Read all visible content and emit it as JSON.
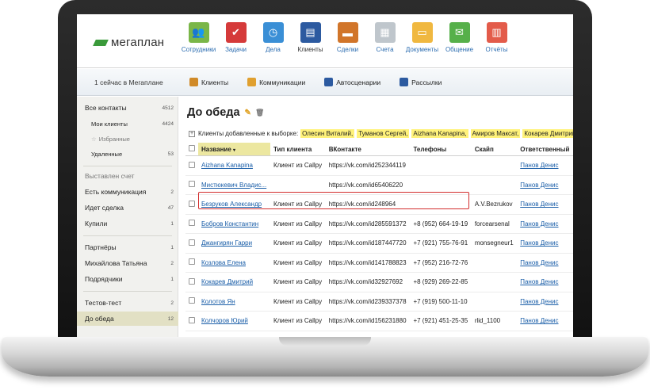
{
  "app": {
    "logo_text": "мегаплан"
  },
  "nav": [
    {
      "label": "Сотрудники",
      "icon": "people-icon",
      "color": "#7ab648"
    },
    {
      "label": "Задачи",
      "icon": "checklist-icon",
      "color": "#d53a3a"
    },
    {
      "label": "Дела",
      "icon": "clock-icon",
      "color": "#3a8fd6"
    },
    {
      "label": "Клиенты",
      "icon": "contact-book-icon",
      "color": "#2c5aa0",
      "active": true
    },
    {
      "label": "Сделки",
      "icon": "briefcase-icon",
      "color": "#d1752a"
    },
    {
      "label": "Счета",
      "icon": "invoice-icon",
      "color": "#bfc6cc"
    },
    {
      "label": "Документы",
      "icon": "folder-icon",
      "color": "#f0b840"
    },
    {
      "label": "Общение",
      "icon": "chat-icon",
      "color": "#56b04a"
    },
    {
      "label": "Отчёты",
      "icon": "report-chart-icon",
      "color": "#e35b4a"
    }
  ],
  "subbar": {
    "online": "1 сейчас в Мегаплане",
    "tabs": [
      {
        "label": "Клиенты",
        "icon": "clients-icon",
        "color": "#d08a28"
      },
      {
        "label": "Коммуникации",
        "icon": "handshake-icon",
        "color": "#e0a030"
      },
      {
        "label": "Автосценарии",
        "icon": "refresh-icon",
        "color": "#2c5aa0"
      },
      {
        "label": "Рассылки",
        "icon": "newsletter-icon",
        "color": "#2c5aa0"
      }
    ]
  },
  "sidebar": {
    "all_contacts": {
      "label": "Все контакты",
      "count": "4512"
    },
    "my_clients": {
      "label": "Мои клиенты",
      "count": "4424"
    },
    "favorites": {
      "label": "Избранные"
    },
    "deleted": {
      "label": "Удаленные",
      "count": "53"
    },
    "invoice": {
      "label": "Выставлен счет"
    },
    "communication": {
      "label": "Есть коммуникация",
      "count": "2"
    },
    "deal": {
      "label": "Идет сделка",
      "count": "47"
    },
    "bought": {
      "label": "Купили",
      "count": "1"
    },
    "partners": {
      "label": "Партнёры",
      "count": "1"
    },
    "mikhailova": {
      "label": "Михайлова Татьяна",
      "count": "2"
    },
    "contractors": {
      "label": "Подрядчики",
      "count": "1"
    },
    "test": {
      "label": "Тестов-тест",
      "count": "2"
    },
    "before_lunch": {
      "label": "До обеда",
      "count": "12"
    }
  },
  "main": {
    "title": "До обеда",
    "filter_label": "Клиенты добавленные к выборке:",
    "filter_chips": [
      "Олесин Виталий,",
      "Туманов Сергей,",
      "Aizhana Kanapina,",
      "Амиров Максат,",
      "Кокарев Дмитрий,"
    ]
  },
  "table": {
    "columns": [
      "Название",
      "Тип клиента",
      "ВКонтакте",
      "Телефоны",
      "Скайп",
      "Ответственный"
    ],
    "rows": [
      {
        "name": "Aizhana Kanapina",
        "type": "Клиент из Callpy",
        "vk": "https://vk.com/id252344119",
        "phone": "",
        "skype": "",
        "owner": "Панов Денис"
      },
      {
        "name": "Мистюкевич Владис...",
        "type": "",
        "vk": "https://vk.com/id65406220",
        "phone": "",
        "skype": "",
        "owner": "Панов Денис"
      },
      {
        "name": "Безруков Александр",
        "type": "Клиент из Callpy",
        "vk": "https://vk.com/id248964",
        "phone": "",
        "skype": "A.V.Bezrukov",
        "owner": "Панов Денис"
      },
      {
        "name": "Бобров Константин",
        "type": "Клиент из Callpy",
        "vk": "https://vk.com/id285591372",
        "phone": "+8 (952) 664-19-19",
        "skype": "forcearsenal",
        "owner": "Панов Денис"
      },
      {
        "name": "Джангирян Гарри",
        "type": "Клиент из Callpy",
        "vk": "https://vk.com/id187447720",
        "phone": "+7 (921) 755-76-91",
        "skype": "monsegneur1",
        "owner": "Панов Денис"
      },
      {
        "name": "Козлова Елена",
        "type": "Клиент из Callpy",
        "vk": "https://vk.com/id141788823",
        "phone": "+7 (952) 216-72-76",
        "skype": "",
        "owner": "Панов Денис"
      },
      {
        "name": "Кокарев Дмитрий",
        "type": "Клиент из Callpy",
        "vk": "https://vk.com/id32927692",
        "phone": "+8 (929) 269-22-85",
        "skype": "",
        "owner": "Панов Денис"
      },
      {
        "name": "Колотов Ян",
        "type": "Клиент из Callpy",
        "vk": "https://vk.com/id239337378",
        "phone": "+7 (919) 500-11-10",
        "skype": "",
        "owner": "Панов Денис"
      },
      {
        "name": "Колчоров Юрий",
        "type": "Клиент из Callpy",
        "vk": "https://vk.com/id156231880",
        "phone": "+7 (921) 451-25-35",
        "skype": "rlid_1100",
        "owner": "Панов Денис"
      }
    ]
  }
}
